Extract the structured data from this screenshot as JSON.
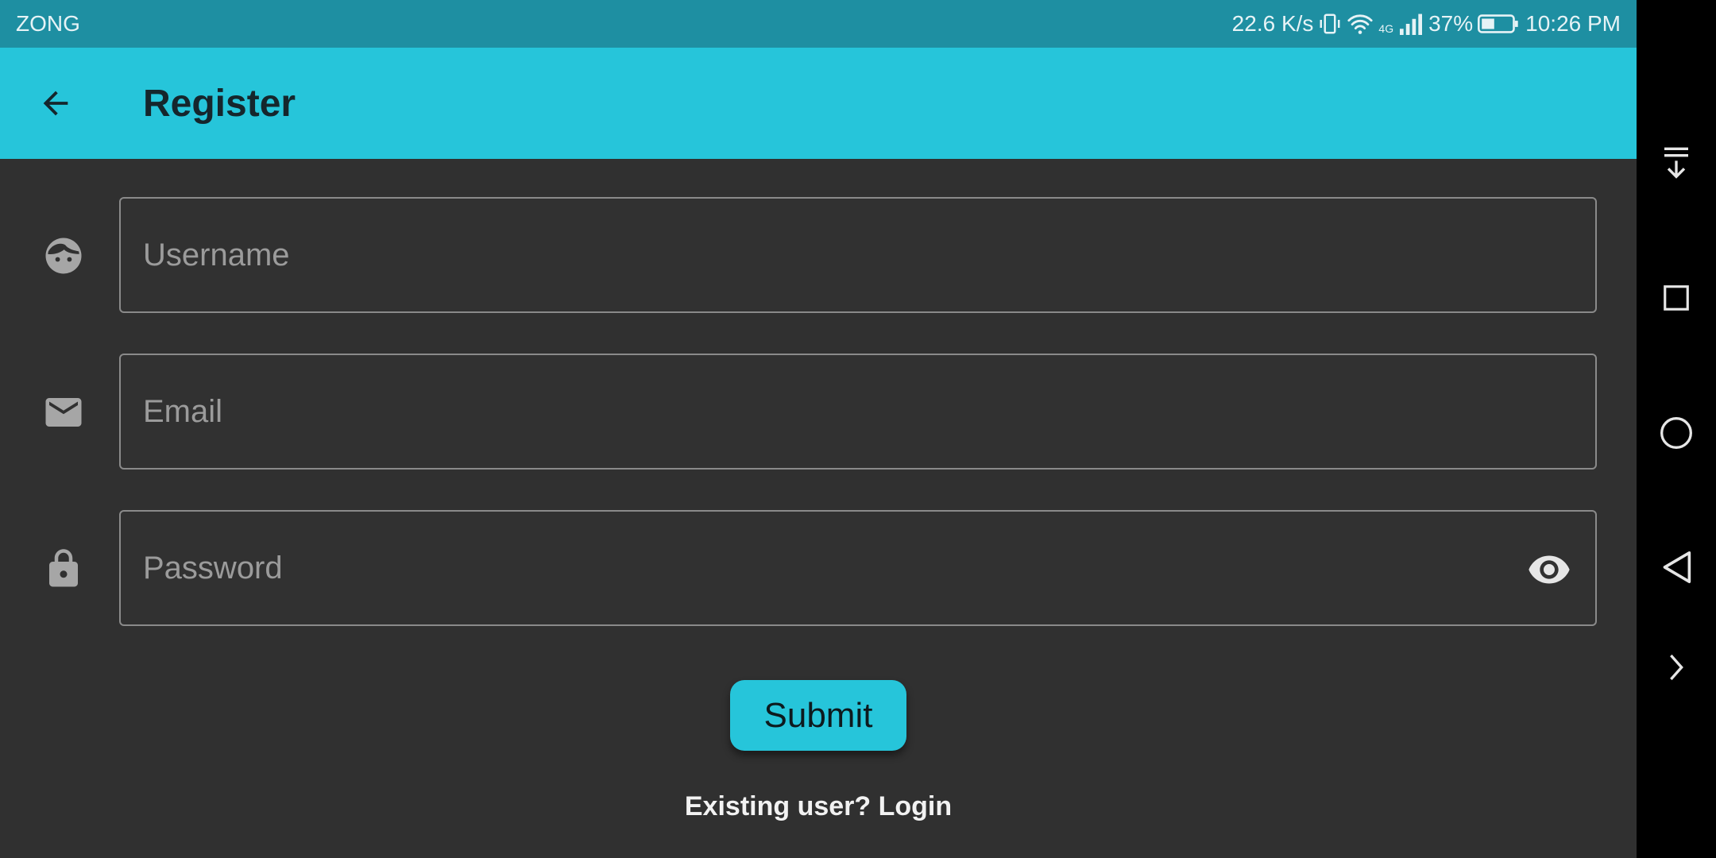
{
  "status_bar": {
    "carrier": "ZONG",
    "net_speed": "22.6 K/s",
    "network_type": "4G",
    "battery": "37%",
    "time": "10:26 PM"
  },
  "app_bar": {
    "title": "Register",
    "back_icon": "arrow-back-icon"
  },
  "form": {
    "username": {
      "placeholder": "Username",
      "value": "",
      "icon": "face-icon"
    },
    "email": {
      "placeholder": "Email",
      "value": "",
      "icon": "mail-icon"
    },
    "password": {
      "placeholder": "Password",
      "value": "",
      "icon": "lock-icon",
      "toggle_icon": "eye-icon"
    },
    "submit_label": "Submit",
    "login_link": "Existing user? Login"
  },
  "nav_bar": {
    "icons": [
      "collapse-down-icon",
      "recents-square-icon",
      "home-circle-icon",
      "back-triangle-icon",
      "expand-chevron-icon"
    ]
  },
  "colors": {
    "status_bar": "#1e8fa2",
    "accent": "#26c5da",
    "background": "#303030",
    "field_border": "#8a8a8a"
  }
}
